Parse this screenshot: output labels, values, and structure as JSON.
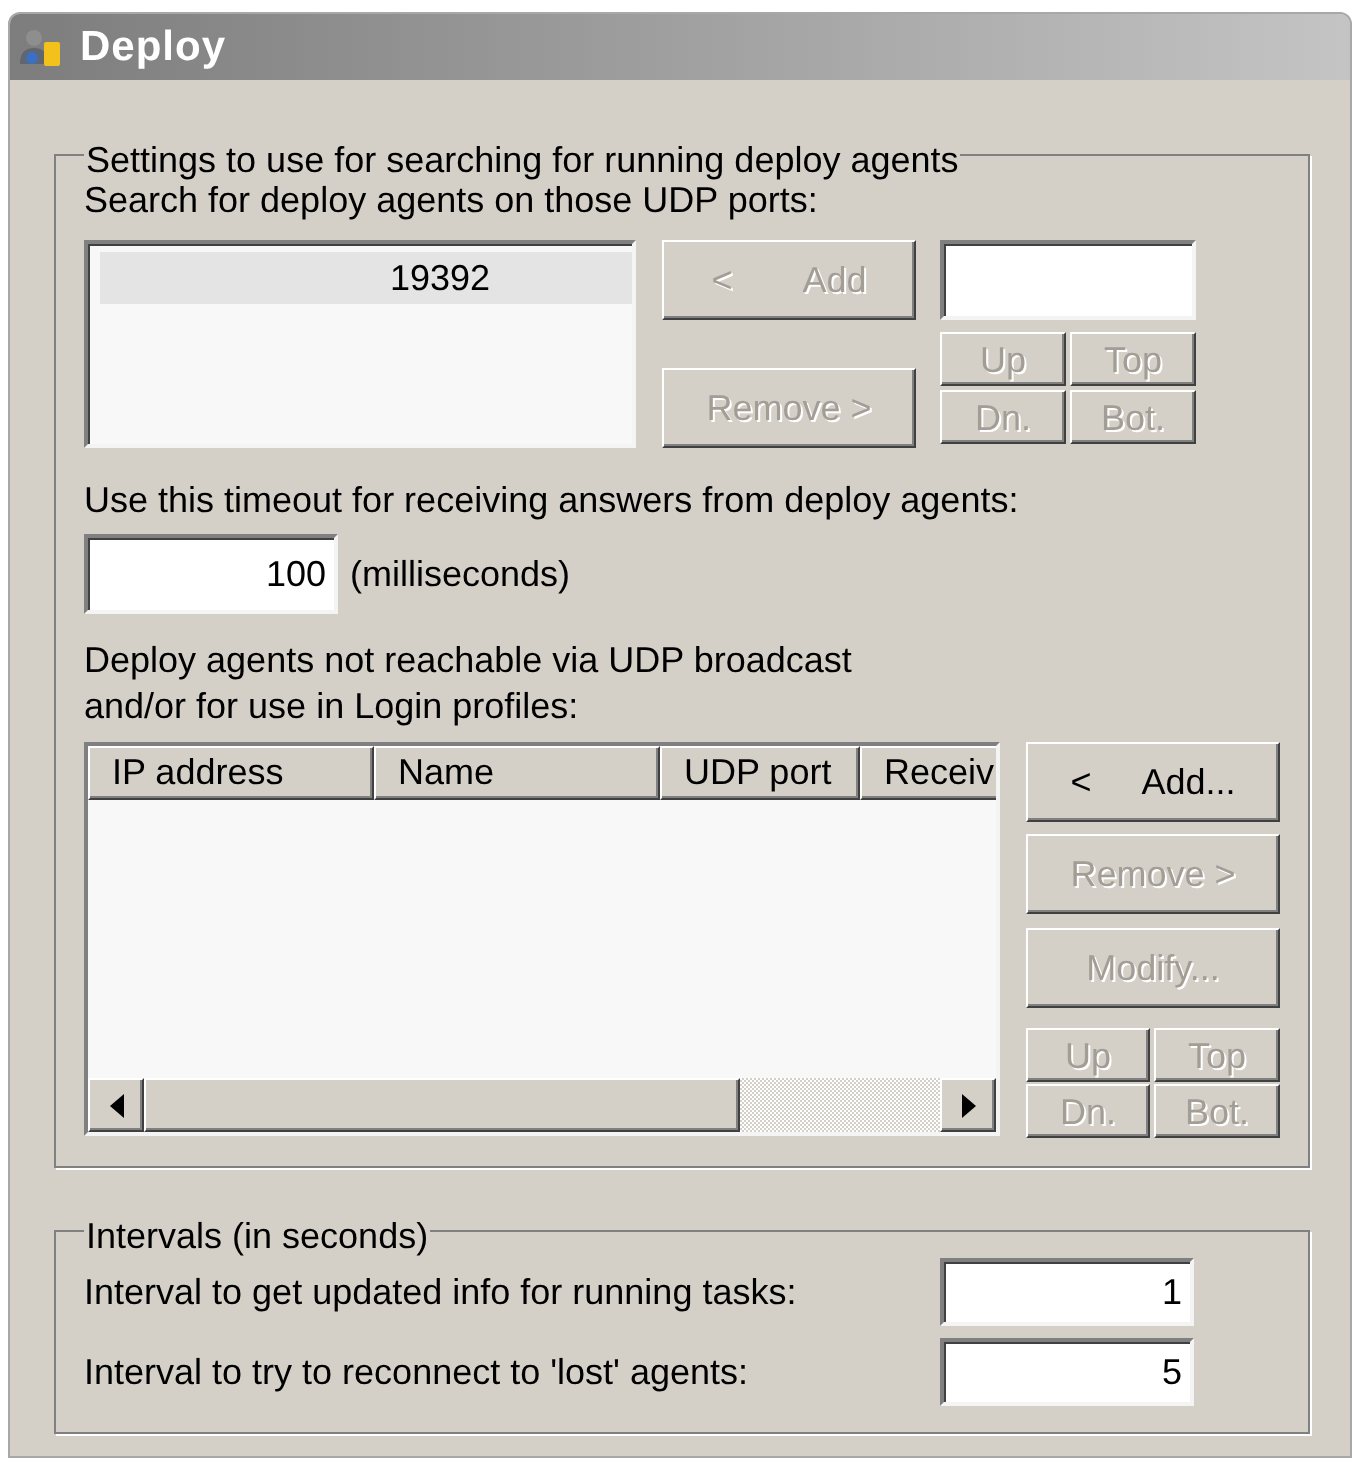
{
  "window": {
    "title": "Deploy"
  },
  "search_settings": {
    "title": "Settings to use for searching for running deploy agents",
    "ports_label": "Search for deploy agents on those UDP ports:",
    "ports": [
      {
        "text": "19392",
        "selected": true
      }
    ],
    "port_buttons": [
      {
        "prefix": "<",
        "label": "Add",
        "disabled": true
      },
      {
        "label": "Remove >",
        "disabled": true
      }
    ],
    "port_order_buttons": [
      {
        "label": "Up",
        "disabled": true
      },
      {
        "label": "Top",
        "disabled": true
      },
      {
        "label": "Dn.",
        "disabled": true
      },
      {
        "label": "Bot.",
        "disabled": true
      }
    ],
    "timeout_label": "Use this timeout for receiving answers from deploy agents:",
    "timeout_field": {
      "value": "100"
    },
    "timeout_unit": "(milliseconds)",
    "agents_label": "Deploy agents not reachable via UDP broadcast and/or for use in Login profiles:",
    "agents_table": {
      "columns": [
        "IP address",
        "Name",
        "UDP port",
        "Receiv"
      ]
    },
    "agent_buttons": [
      {
        "prefix": "<",
        "label": "Add...",
        "disabled": false
      },
      {
        "label": "Remove >",
        "disabled": true
      },
      {
        "label": "Modify...",
        "disabled": true
      }
    ],
    "agent_order_buttons": [
      {
        "label": "Up",
        "disabled": true
      },
      {
        "label": "Top",
        "disabled": true
      },
      {
        "label": "Dn.",
        "disabled": true
      },
      {
        "label": "Bot.",
        "disabled": true
      }
    ]
  },
  "intervals": {
    "title": "Intervals (in seconds)",
    "rows": [
      {
        "label": "Interval to get updated info for running tasks:",
        "value": "1"
      },
      {
        "label": "Interval to try to reconnect to 'lost' agents:",
        "value": "5"
      }
    ]
  }
}
